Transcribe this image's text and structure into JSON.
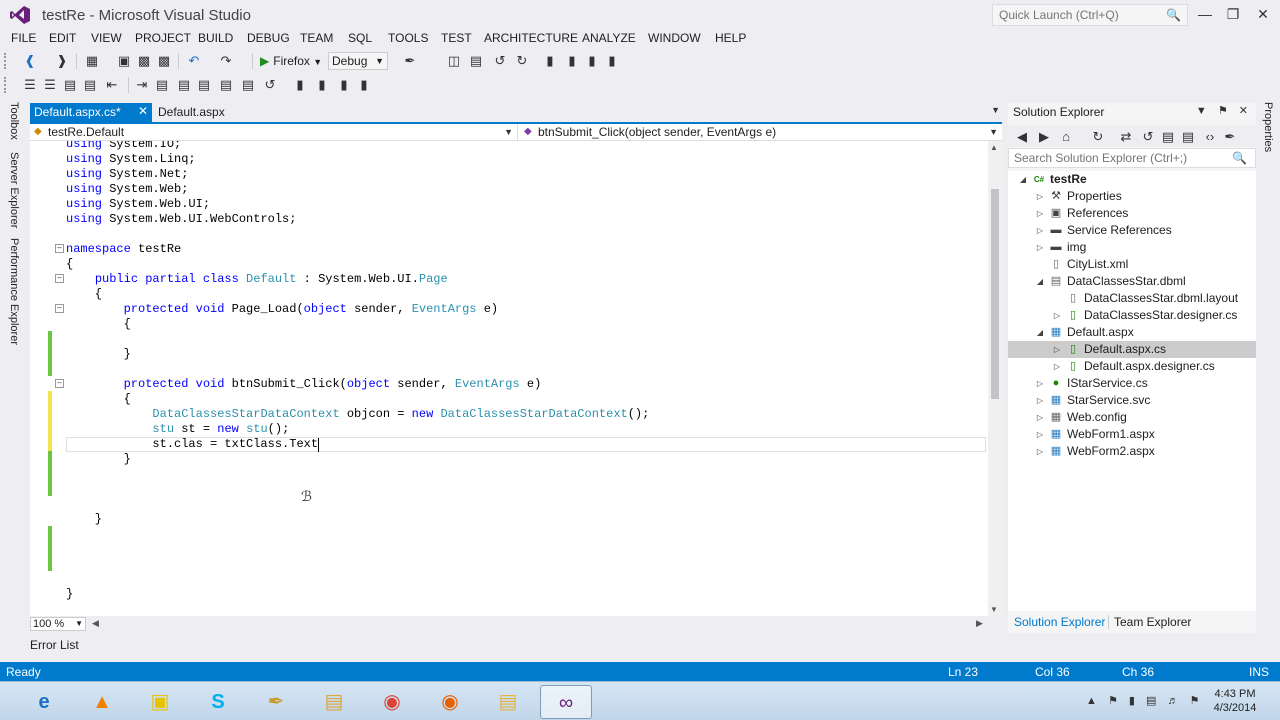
{
  "window": {
    "title": "testRe - Microsoft Visual Studio",
    "quick_launch_placeholder": "Quick Launch (Ctrl+Q)"
  },
  "menu": [
    "FILE",
    "EDIT",
    "VIEW",
    "PROJECT",
    "BUILD",
    "DEBUG",
    "TEAM",
    "SQL",
    "TOOLS",
    "TEST",
    "ARCHITECTURE",
    "ANALYZE",
    "WINDOW",
    "HELP"
  ],
  "toolbar": {
    "start_label": "Firefox",
    "config_label": "Debug"
  },
  "left_rail": [
    "Toolbox",
    "Server Explorer",
    "Performance Explorer"
  ],
  "right_rail": [
    "Properties"
  ],
  "editor": {
    "tabs": [
      {
        "label": "Default.aspx.cs*",
        "active": true
      },
      {
        "label": "Default.aspx",
        "active": false
      }
    ],
    "nav_class": "testRe.Default",
    "nav_member": "btnSubmit_Click(object sender, EventArgs e)",
    "zoom": "100 %",
    "code_lines": [
      [
        [
          "kw",
          "using"
        ],
        [
          "tx",
          " System.IO;"
        ]
      ],
      [
        [
          "kw",
          "using"
        ],
        [
          "tx",
          " System.Linq;"
        ]
      ],
      [
        [
          "kw",
          "using"
        ],
        [
          "tx",
          " System.Net;"
        ]
      ],
      [
        [
          "kw",
          "using"
        ],
        [
          "tx",
          " System.Web;"
        ]
      ],
      [
        [
          "kw",
          "using"
        ],
        [
          "tx",
          " System.Web.UI;"
        ]
      ],
      [
        [
          "kw",
          "using"
        ],
        [
          "tx",
          " System.Web.UI.WebControls;"
        ]
      ],
      [],
      [
        [
          "kw",
          "namespace"
        ],
        [
          "tx",
          " testRe"
        ]
      ],
      [
        [
          "tx",
          "{"
        ]
      ],
      [
        [
          "tx",
          "    "
        ],
        [
          "kw",
          "public partial class"
        ],
        [
          "tx",
          " "
        ],
        [
          "ty",
          "Default"
        ],
        [
          "tx",
          " : System.Web.UI."
        ],
        [
          "ty",
          "Page"
        ]
      ],
      [
        [
          "tx",
          "    {"
        ]
      ],
      [
        [
          "tx",
          "        "
        ],
        [
          "kw",
          "protected void"
        ],
        [
          "tx",
          " Page_Load("
        ],
        [
          "kw",
          "object"
        ],
        [
          "tx",
          " sender, "
        ],
        [
          "ty",
          "EventArgs"
        ],
        [
          "tx",
          " e)"
        ]
      ],
      [
        [
          "tx",
          "        {"
        ]
      ],
      [],
      [
        [
          "tx",
          "        }"
        ]
      ],
      [],
      [
        [
          "tx",
          "        "
        ],
        [
          "kw",
          "protected void"
        ],
        [
          "tx",
          " btnSubmit_Click("
        ],
        [
          "kw",
          "object"
        ],
        [
          "tx",
          " sender, "
        ],
        [
          "ty",
          "EventArgs"
        ],
        [
          "tx",
          " e)"
        ]
      ],
      [
        [
          "tx",
          "        {"
        ]
      ],
      [
        [
          "tx",
          "            "
        ],
        [
          "ty",
          "DataClassesStarDataContext"
        ],
        [
          "tx",
          " objcon = "
        ],
        [
          "kw",
          "new"
        ],
        [
          "tx",
          " "
        ],
        [
          "ty",
          "DataClassesStarDataContext"
        ],
        [
          "tx",
          "();"
        ]
      ],
      [
        [
          "tx",
          "            "
        ],
        [
          "ty",
          "stu"
        ],
        [
          "tx",
          " st = "
        ],
        [
          "kw",
          "new"
        ],
        [
          "tx",
          " "
        ],
        [
          "ty",
          "stu"
        ],
        [
          "tx",
          "();"
        ]
      ],
      [
        [
          "tx",
          "            st.clas = txtClass.Text"
        ]
      ],
      [
        [
          "tx",
          "        }"
        ]
      ],
      [],
      [],
      [],
      [
        [
          "tx",
          "    }"
        ]
      ],
      [],
      [],
      [],
      [],
      [
        [
          "tx",
          "}"
        ]
      ]
    ]
  },
  "error_list_label": "Error List",
  "solution_explorer": {
    "title": "Solution Explorer",
    "search_placeholder": "Search Solution Explorer (Ctrl+;)",
    "items": [
      {
        "label": "testRe",
        "depth": 0,
        "expander": "open",
        "icon": "csharp-project-icon",
        "bold": true
      },
      {
        "label": "Properties",
        "depth": 1,
        "expander": "closed",
        "icon": "wrench-icon"
      },
      {
        "label": "References",
        "depth": 1,
        "expander": "closed",
        "icon": "references-icon"
      },
      {
        "label": "Service References",
        "depth": 1,
        "expander": "closed",
        "icon": "folder-icon"
      },
      {
        "label": "img",
        "depth": 1,
        "expander": "closed",
        "icon": "folder-icon"
      },
      {
        "label": "CityList.xml",
        "depth": 1,
        "expander": "none",
        "icon": "xml-file-icon"
      },
      {
        "label": "DataClassesStar.dbml",
        "depth": 1,
        "expander": "open",
        "icon": "dbml-file-icon"
      },
      {
        "label": "DataClassesStar.dbml.layout",
        "depth": 2,
        "expander": "none",
        "icon": "layout-file-icon"
      },
      {
        "label": "DataClassesStar.designer.cs",
        "depth": 2,
        "expander": "closed",
        "icon": "cs-file-icon"
      },
      {
        "label": "Default.aspx",
        "depth": 1,
        "expander": "open",
        "icon": "aspx-file-icon"
      },
      {
        "label": "Default.aspx.cs",
        "depth": 2,
        "expander": "closed",
        "icon": "cs-file-icon",
        "selected": true
      },
      {
        "label": "Default.aspx.designer.cs",
        "depth": 2,
        "expander": "closed",
        "icon": "cs-file-icon"
      },
      {
        "label": "IStarService.cs",
        "depth": 1,
        "expander": "closed",
        "icon": "interface-file-icon"
      },
      {
        "label": "StarService.svc",
        "depth": 1,
        "expander": "closed",
        "icon": "svc-file-icon"
      },
      {
        "label": "Web.config",
        "depth": 1,
        "expander": "closed",
        "icon": "config-file-icon"
      },
      {
        "label": "WebForm1.aspx",
        "depth": 1,
        "expander": "closed",
        "icon": "aspx-file-icon"
      },
      {
        "label": "WebForm2.aspx",
        "depth": 1,
        "expander": "closed",
        "icon": "aspx-file-icon"
      }
    ],
    "bottom_tabs": [
      "Solution Explorer",
      "Team Explorer"
    ]
  },
  "status": {
    "state": "Ready",
    "line": "Ln 23",
    "col": "Col 36",
    "ch": "Ch 36",
    "mode": "INS"
  },
  "taskbar": {
    "apps": [
      {
        "name": "internet-explorer-icon",
        "active": false
      },
      {
        "name": "vlc-icon",
        "active": false
      },
      {
        "name": "sticky-notes-icon",
        "active": false
      },
      {
        "name": "skype-icon",
        "active": false
      },
      {
        "name": "tools-icon",
        "active": false
      },
      {
        "name": "file-explorer-icon",
        "active": false
      },
      {
        "name": "chrome-icon",
        "active": false
      },
      {
        "name": "firefox-icon",
        "active": false
      },
      {
        "name": "folder-app-icon",
        "active": false
      },
      {
        "name": "visual-studio-icon",
        "active": true
      }
    ],
    "clock_time": "4:43 PM",
    "clock_date": "4/3/2014"
  },
  "colors": {
    "accent": "#007acc",
    "keyword": "#0000ff",
    "type": "#2b91af",
    "change_saved": "#6cc644",
    "change_unsaved": "#f2e44e"
  }
}
